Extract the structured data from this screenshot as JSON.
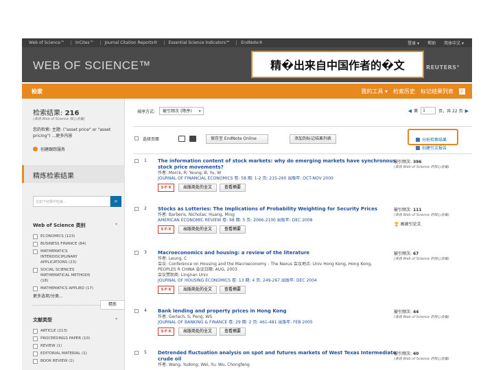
{
  "topbar": {
    "links": [
      "Web of Science™",
      "InCites™",
      "Journal Citation Reports®",
      "Essential Science Indicators℠",
      "EndNote®"
    ],
    "right": [
      "登录 ▾",
      "帮助",
      "简体中文 ▾"
    ]
  },
  "header": {
    "logo": "WEB OF SCIENCE™",
    "brand": "N REUTERS°"
  },
  "overlay_text": "精�出来自中国作者的�文",
  "orangebar": {
    "tab": "检索",
    "links": [
      "我的工具 ▾",
      "检索历史",
      "标记结果列表"
    ],
    "count": "0"
  },
  "sidebar": {
    "results_label": "检索结果:",
    "results_count": "216",
    "results_sub": "(来自 Web of Science 核心合集)",
    "query": "您的检索: 主题: (\"asset price\" or \"asset pricing\") ...更多内容",
    "alert_link": "创建跟踪服务",
    "refine_title": "精炼检索结果",
    "search_placeholder": "在如下结果中检索...",
    "category_heading": "Web of Science 类别",
    "categories": [
      "ECONOMICS (123)",
      "BUSINESS FINANCE (84)",
      "MATHEMATICS INTERDISCIPLINARY APPLICATIONS (23)",
      "SOCIAL SCIENCES MATHEMATICAL METHODS (18)",
      "MATHEMATICS APPLIED (17)"
    ],
    "more_options": "更多选项/分类...",
    "refine_button": "精炼",
    "doctype_heading": "文献类型",
    "doctypes": [
      "ARTICLE (213)",
      "PROCEEDINGS PAPER (10)",
      "REVIEW (1)",
      "EDITORIAL MATERIAL (1)",
      "BOOK REVIEW (1)"
    ]
  },
  "main": {
    "sort_label": "排序方式:",
    "sort_value": "被引频次 (降序)",
    "pager": {
      "prefix": "第",
      "page": "1",
      "suffix": "页，共 22 页"
    },
    "select_page": "选择页面",
    "save_to": "保存至 EndNote Online",
    "add_marked": "添加到标记结果列表",
    "analyze": "分析检索结果",
    "citation_report": "创建引文报告",
    "sfx_label": "S·F·X",
    "fulltext_btn": "出版商处的全文",
    "abstract_btn": "查看摘要",
    "cited_label": "被引频次:",
    "cited_source": "(来自 Web of Science 的核心合集)",
    "highly_cited": "高被引论文",
    "records": [
      {
        "num": "1",
        "title": "The information content of stock markets: why do emerging markets have synchronous stock price movements?",
        "authors": "作者: Morck, R; Yeung, B; Yu, W",
        "source": "JOURNAL OF FINANCIAL ECONOMICS 卷: 58 期: 1-2 页: 215-260 出版年: OCT-NOV 2000",
        "extra": [],
        "cited": "396",
        "hot": false
      },
      {
        "num": "2",
        "title": "Stocks as Lotteries: The Implications of Probability Weighting for Security Prices",
        "authors": "作者: Barberis, Nicholas; Huang, Ming",
        "source": "AMERICAN ECONOMIC REVIEW 卷: 98 期: 5 页: 2066-2100 出版年: DEC 2008",
        "extra": [],
        "cited": "111",
        "hot": true
      },
      {
        "num": "3",
        "title": "Macroeconomics and housing: a review of the literature",
        "authors": "作者: Leung, C",
        "source": "会议: Conference on Housing and the Macroeconomy - The Nexus 会议地点: Univ Hong Kong, Hong Kong,",
        "extra": [
          "PEOPLES R CHINA 会议日期: AUG, 2003",
          "会议赞助商: Lingnan Univ",
          "JOURNAL OF HOUSING ECONOMICS 卷: 13 期: 4 页: 249-267 出版年: DEC 2004"
        ],
        "cited": "67",
        "hot": false
      },
      {
        "num": "4",
        "title": "Bank lending and property prices in Hong Kong",
        "authors": "作者: Gerlach, S; Peng, WS",
        "source": "JOURNAL OF BANKING & FINANCE 卷: 29 期: 2 页: 461-481 出版年: FEB 2005",
        "extra": [],
        "cited": "44",
        "hot": false
      },
      {
        "num": "5",
        "title": "Detrended fluctuation analysis on spot and futures markets of West Texas Intermediate crude oil",
        "authors": "作者: Wang, Yudong; Wei, Yu; Wu, Chongfeng",
        "source": "",
        "extra": [],
        "cited": "40",
        "hot": false
      }
    ]
  }
}
